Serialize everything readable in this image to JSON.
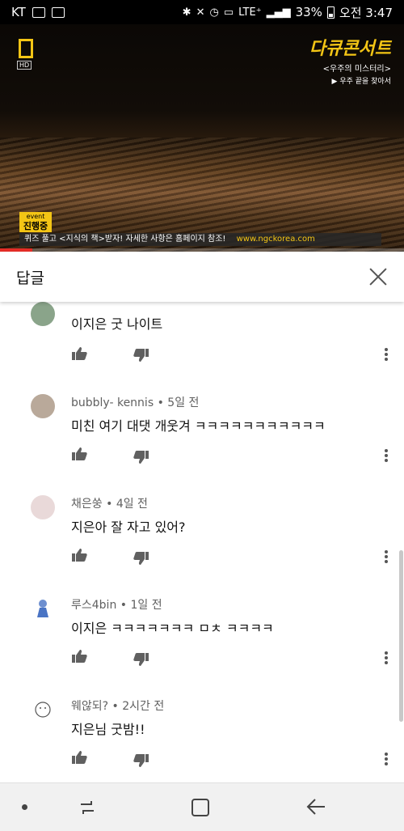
{
  "status_bar": {
    "carrier": "KT",
    "network": "LTE⁺",
    "battery_percent": "33%",
    "time": "오전 3:47"
  },
  "video": {
    "hd_badge": "HD",
    "doc_title": "다큐콘서트",
    "doc_subtitle": "<우주의 미스터리>",
    "doc_episode": "▶ 우주 끝을 찾아서",
    "event_line1": "event",
    "event_line2": "진행중",
    "ticker_text": "퀴즈 풀고 <지식의 책>받자! 자세한 사항은 홈페이지 참조!",
    "ticker_url": "www.ngckorea.com",
    "progress_fraction": 0.08,
    "accent_color": "#e52d27"
  },
  "replies": {
    "title": "답글"
  },
  "comments": [
    {
      "author": "",
      "time": "",
      "text": "이지은 굿 나이트"
    },
    {
      "author": "bubbly- kennis",
      "time": "5일 전",
      "text": "미친 여기 대댓 개웃겨 ㅋㅋㅋㅋㅋㅋㅋㅋㅋㅋㅋ"
    },
    {
      "author": "채은쑹",
      "time": "4일 전",
      "text": "지은아 잘 자고 있어?"
    },
    {
      "author": "루스4bin",
      "time": "1일 전",
      "text": "이지은 ㅋㅋㅋㅋㅋㅋㅋ ㅁㅊ ㅋㅋㅋㅋ"
    },
    {
      "author": "웨않되?",
      "time": "2시간 전",
      "text": "지은님 굿밤!!"
    }
  ],
  "icons": {
    "like": "thumb-up-icon",
    "dislike": "thumb-down-icon",
    "more": "more-vert-icon",
    "close": "close-icon"
  }
}
